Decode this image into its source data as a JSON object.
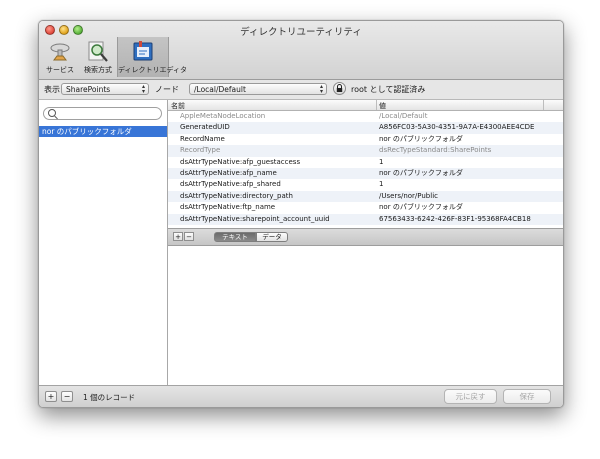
{
  "window": {
    "title": "ディレクトリユーティリティ"
  },
  "toolbar": {
    "items": [
      {
        "label": "サービス",
        "icon": "services-icon"
      },
      {
        "label": "検索方式",
        "icon": "search-policy-icon"
      },
      {
        "label": "ディレクトリエディタ",
        "icon": "directory-editor-icon"
      }
    ]
  },
  "nodebar": {
    "view_label": "表示",
    "view_value": "SharePoints",
    "node_label": "ノード",
    "node_value": "/Local/Default",
    "auth_text": "root として認証済み"
  },
  "sidebar": {
    "records": [
      "nor のパブリックフォルダ"
    ]
  },
  "table": {
    "headers": [
      "名前",
      "値"
    ],
    "rows": [
      {
        "name": "AppleMetaNodeLocation",
        "value": "/Local/Default",
        "dim": true
      },
      {
        "name": "GeneratedUID",
        "value": "A856FC03-5A30-4351-9A7A-E4300AEE4CDE",
        "dim": false
      },
      {
        "name": "RecordName",
        "value": "nor のパブリックフォルダ",
        "dim": false
      },
      {
        "name": "RecordType",
        "value": "dsRecTypeStandard:SharePoints",
        "dim": true
      },
      {
        "name": "dsAttrTypeNative:afp_guestaccess",
        "value": "1",
        "dim": false
      },
      {
        "name": "dsAttrTypeNative:afp_name",
        "value": "nor のパブリックフォルダ",
        "dim": false
      },
      {
        "name": "dsAttrTypeNative:afp_shared",
        "value": "1",
        "dim": false
      },
      {
        "name": "dsAttrTypeNative:directory_path",
        "value": "/Users/nor/Public",
        "dim": false
      },
      {
        "name": "dsAttrTypeNative:ftp_name",
        "value": "nor のパブリックフォルダ",
        "dim": false
      },
      {
        "name": "dsAttrTypeNative:sharepoint_account_uuid",
        "value": "67563433-6242-426F-83F1-95368FA4CB18",
        "dim": false
      }
    ]
  },
  "tablefoot": {
    "add": "+",
    "remove": "−",
    "text_tab": "テキスト",
    "data_tab": "データ"
  },
  "bottombar": {
    "add": "+",
    "remove": "−",
    "count": "1 個のレコード",
    "revert": "元に戻す",
    "save": "保存"
  }
}
